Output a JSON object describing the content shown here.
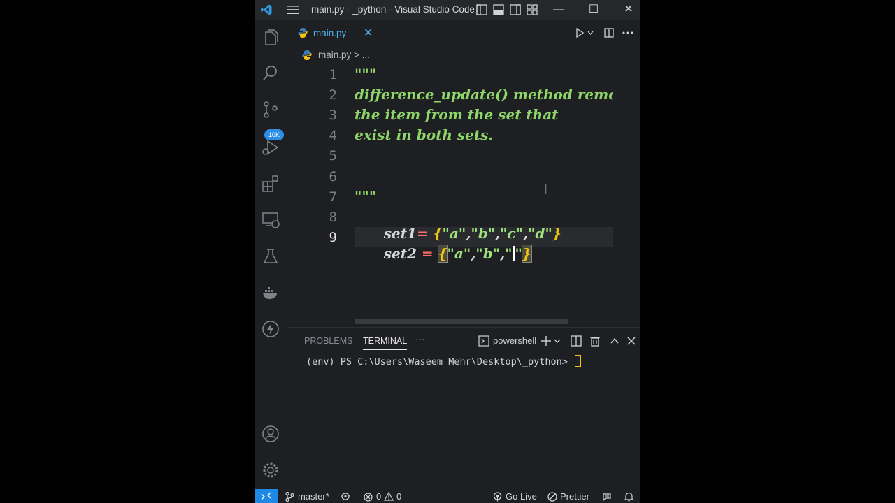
{
  "window": {
    "title": "main.py - _python - Visual Studio Code",
    "minimize": "—",
    "maximize": "☐",
    "close": "✕"
  },
  "tab": {
    "label": "main.py",
    "close": "✕"
  },
  "breadcrumb": {
    "file": "main.py",
    "sep": " > ",
    "more": "..."
  },
  "activity_badge": "10K",
  "editor": {
    "line_numbers": [
      "1",
      "2",
      "3",
      "4",
      "5",
      "6",
      "7",
      "8",
      "9"
    ],
    "lines": [
      "\"\"\"",
      "difference_update() method remo",
      "the item from the set that",
      "exist in both sets.",
      "",
      "",
      "\"\"\"",
      "set1= {\"a\",\"b\",\"c\",\"d\"}",
      "set2 = {\"a\",\"b\",\"\"}"
    ],
    "l8": {
      "var": "set1",
      "op": "=",
      "open": "{",
      "s1": "\"a\"",
      "c1": ",",
      "s2": "\"b\"",
      "c2": ",",
      "s3": "\"c\"",
      "c3": ",",
      "s4": "\"d\"",
      "close": "}"
    },
    "l9": {
      "var": "set2",
      "op": "=",
      "open": "{",
      "s1": "\"a\"",
      "c1": ",",
      "s2": "\"b\"",
      "c2": ",",
      "q1": "\"",
      "q2": "\"",
      "close": "}"
    }
  },
  "panel": {
    "tabs": [
      "PROBLEMS",
      "TERMINAL"
    ],
    "more": "···",
    "terminal_name": "powershell",
    "prompt": "(env) PS C:\\Users\\Waseem Mehr\\Desktop\\_python> "
  },
  "status": {
    "branch": "master*",
    "errors": "0",
    "warnings": "0",
    "golive": "Go Live",
    "prettier": "Prettier"
  },
  "colors": {
    "accent": "#1e88e5",
    "code": "#8fd66a",
    "brace": "#f2c511",
    "operator": "#ff6b6b"
  }
}
